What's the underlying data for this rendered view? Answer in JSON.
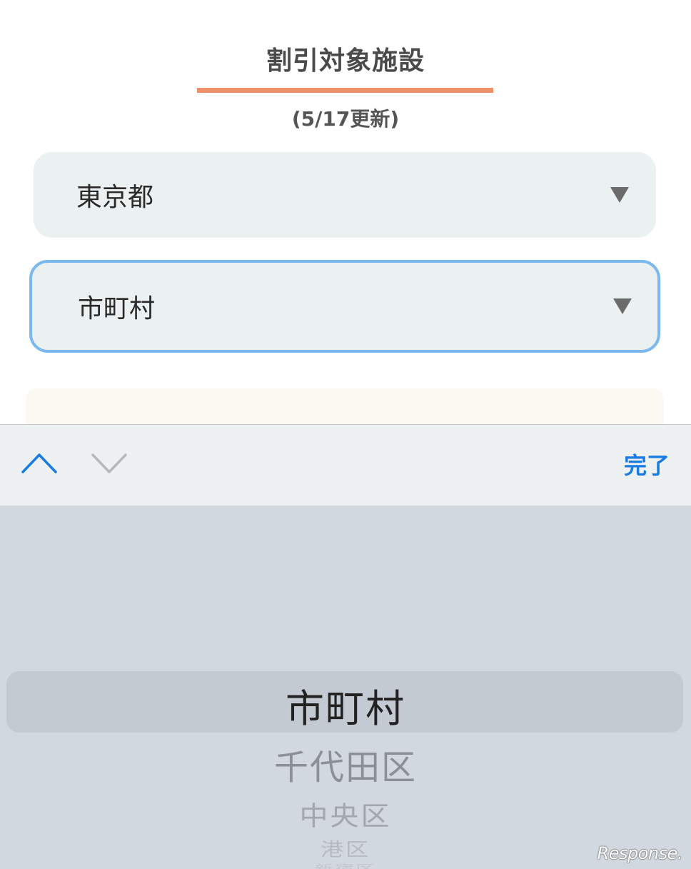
{
  "header": {
    "title": "割引対象施設",
    "updated": "(5/17更新)"
  },
  "prefecture_select": {
    "value": "東京都",
    "icon": "triangle-down-icon"
  },
  "municipality_select": {
    "value": "市町村",
    "icon": "triangle-down-icon",
    "focused": true
  },
  "toolbar": {
    "prev_icon": "chevron-up-icon",
    "next_icon": "chevron-down-icon",
    "done_label": "完了"
  },
  "picker": {
    "selected": "市町村",
    "items": [
      "千代田区",
      "中央区",
      "港区",
      "新宿区"
    ]
  },
  "watermark": "Response.",
  "colors": {
    "accent_underline": "#f0906a",
    "focus_border": "#7ab8ee",
    "done_blue": "#1a7be0",
    "picker_bg": "#d1d8df"
  }
}
